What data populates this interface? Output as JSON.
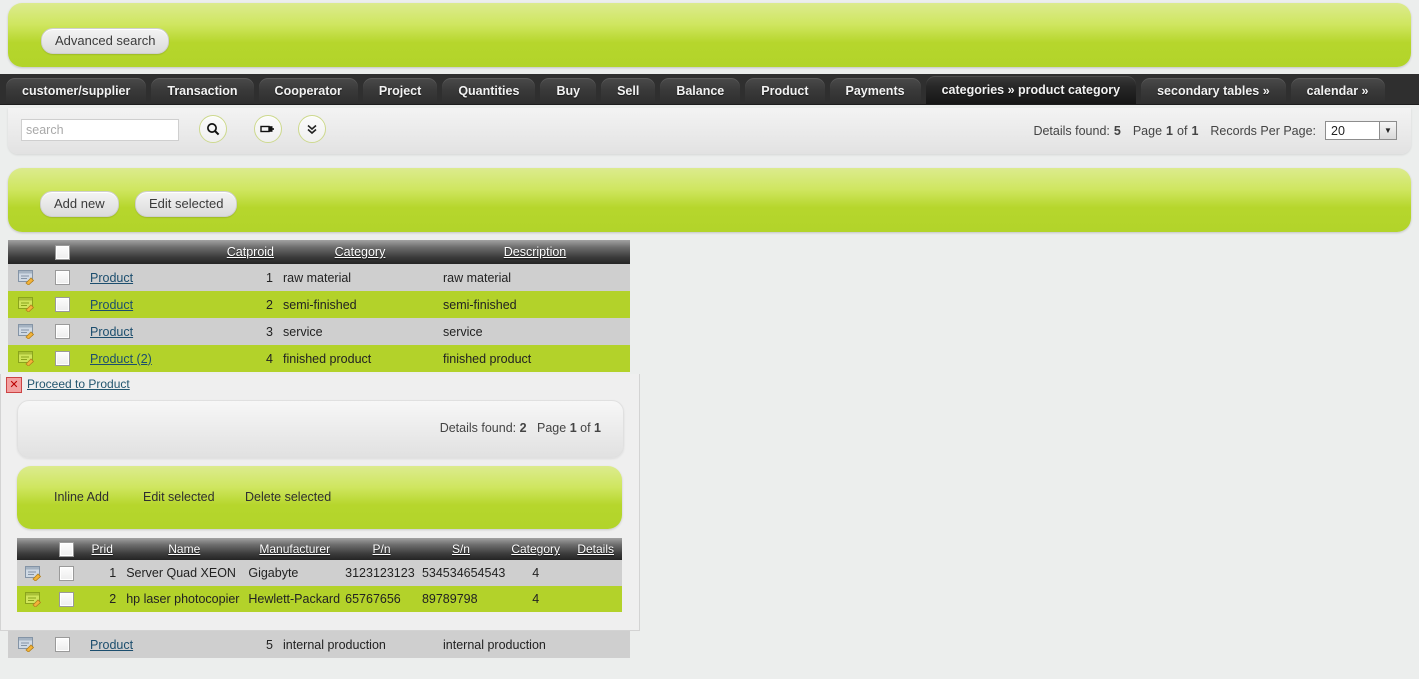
{
  "header": {
    "advanced_search_label": "Advanced search"
  },
  "tabs": [
    {
      "label": "customer/supplier",
      "active": false
    },
    {
      "label": "Transaction",
      "active": false
    },
    {
      "label": "Cooperator",
      "active": false
    },
    {
      "label": "Project",
      "active": false
    },
    {
      "label": "Quantities",
      "active": false
    },
    {
      "label": "Buy",
      "active": false
    },
    {
      "label": "Sell",
      "active": false
    },
    {
      "label": "Balance",
      "active": false
    },
    {
      "label": "Product",
      "active": false
    },
    {
      "label": "Payments",
      "active": false
    },
    {
      "label": "categories » product category",
      "active": true
    },
    {
      "label": "secondary tables »",
      "active": false
    },
    {
      "label": "calendar »",
      "active": false
    }
  ],
  "search": {
    "placeholder": "search",
    "value": "",
    "search_icon": "magnifier-icon",
    "filter_icon": "filter-tag-icon",
    "expand_icon": "double-chevron-down-icon"
  },
  "pager": {
    "details_found_label": "Details found:",
    "details_found_value": "5",
    "page_label": "Page",
    "page_value": "1",
    "of_label": "of",
    "pages_value": "1",
    "records_per_page_label": "Records Per Page:",
    "records_per_page_value": "20",
    "dropdown_arrow": "▼"
  },
  "actions": {
    "add_new_label": "Add new",
    "edit_selected_label": "Edit selected"
  },
  "main_table": {
    "columns": [
      "",
      "",
      "",
      "Catproid",
      "Category",
      "Description"
    ],
    "headers": {
      "catproid": "Catproid",
      "category": "Category",
      "description": "Description"
    },
    "rows": [
      {
        "link": "Product",
        "catproid": "1",
        "category": "raw material",
        "description": "raw material",
        "highlight": false
      },
      {
        "link": "Product",
        "catproid": "2",
        "category": "semi-finished",
        "description": "semi-finished",
        "highlight": true
      },
      {
        "link": "Product",
        "catproid": "3",
        "category": "service",
        "description": "service",
        "highlight": false
      },
      {
        "link": "Product (2)",
        "catproid": "4",
        "category": "finished product",
        "description": "finished product",
        "highlight": true
      }
    ],
    "last_row": {
      "link": "Product",
      "catproid": "5",
      "category": "internal production",
      "description": "internal production"
    }
  },
  "detail_panel": {
    "close_icon": "✕",
    "proceed_link": "Proceed to Product",
    "info": {
      "details_found_label": "Details found:",
      "details_found_value": "2",
      "page_label": "Page",
      "page_value": "1",
      "of_label": "of",
      "pages_value": "1"
    },
    "toolbar": {
      "inline_add_label": "Inline Add",
      "edit_selected_label": "Edit selected",
      "delete_selected_label": "Delete selected"
    },
    "table": {
      "headers": {
        "prid": "Prid",
        "name": "Name",
        "manufacturer": "Manufacturer",
        "pn": "P/n",
        "sn": "S/n",
        "category": "Category",
        "details": "Details"
      },
      "rows": [
        {
          "prid": "1",
          "name": "Server Quad XEON",
          "manufacturer": "Gigabyte",
          "pn": "3123123123",
          "sn": "534534654543",
          "category": "4",
          "details": "",
          "highlight": false
        },
        {
          "prid": "2",
          "name": "hp laser photocopier",
          "manufacturer": "Hewlett-Packard",
          "pn": "65767656",
          "sn": "89789798",
          "category": "4",
          "details": "",
          "highlight": true
        }
      ]
    }
  },
  "colors": {
    "accent_green": "#b2d42a",
    "row_green": "#b3d22a",
    "row_gray": "#cfcfcf",
    "tab_dark": "#2f2f2f",
    "link_blue": "#1c4e6e"
  }
}
